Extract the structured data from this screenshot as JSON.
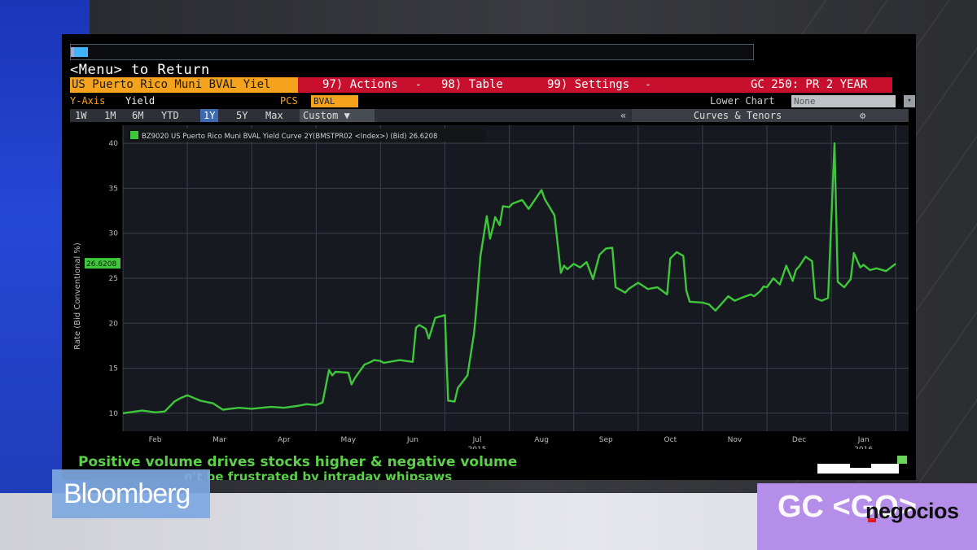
{
  "command": {
    "menu_return": "<Menu> to Return"
  },
  "toolbar": {
    "security": "US Puerto Rico Muni BVAL Yiel",
    "actions": "97) Actions",
    "table": "98) Table",
    "settings": "99) Settings",
    "function": "GC 250: PR 2 YEAR",
    "dropdown_glyph": "-"
  },
  "options": {
    "y_axis_label": "Y-Axis",
    "y_axis_value": "Yield",
    "pcs_label": "PCS",
    "pcs_value": "BVAL",
    "lower_chart_label": "Lower Chart",
    "lower_chart_value": "None"
  },
  "ranges": {
    "items": [
      "1W",
      "1M",
      "6M",
      "YTD",
      "1Y",
      "5Y",
      "Max"
    ],
    "selected": "1Y",
    "custom": "Custom ▼",
    "collapse": "«",
    "curves_tenors": "Curves & Tenors",
    "gear": "⚙"
  },
  "chart_data": {
    "type": "line",
    "legend": "BZ9020 US Puerto Rico Muni BVAL Yield Curve 2Y(BMSTPR02 <Index>) (Bid) 26.6208",
    "ylabel": "Rate (Bid Conventional %)",
    "ylim": [
      8,
      42
    ],
    "yticks": [
      10,
      15,
      20,
      25,
      30,
      35,
      40
    ],
    "last_value_label": "26.6208",
    "last_value": 26.6208,
    "x_ticks": [
      {
        "label": "Feb",
        "x": 0.5
      },
      {
        "label": "Mar",
        "x": 1.5
      },
      {
        "label": "Apr",
        "x": 2.5
      },
      {
        "label": "May",
        "x": 3.5
      },
      {
        "label": "Jun",
        "x": 4.5
      },
      {
        "label": "Jul",
        "x": 5.5
      },
      {
        "label": "Aug",
        "x": 6.5
      },
      {
        "label": "Sep",
        "x": 7.5
      },
      {
        "label": "Oct",
        "x": 8.5
      },
      {
        "label": "Nov",
        "x": 9.5
      },
      {
        "label": "Dec",
        "x": 10.5
      },
      {
        "label": "Jan",
        "x": 11.5
      }
    ],
    "year_labels": [
      {
        "label": "2015",
        "x": 5.5
      },
      {
        "label": "2016",
        "x": 11.5
      }
    ],
    "x_range": [
      0,
      12.2
    ],
    "line_color": "#3ec73a",
    "x": [
      0.0,
      0.3,
      0.5,
      0.65,
      0.8,
      0.9,
      1.0,
      1.2,
      1.4,
      1.55,
      1.8,
      2.0,
      2.3,
      2.5,
      2.7,
      2.85,
      3.0,
      3.1,
      3.2,
      3.25,
      3.3,
      3.5,
      3.55,
      3.6,
      3.75,
      3.85,
      3.9,
      4.0,
      4.05,
      4.3,
      4.5,
      4.55,
      4.6,
      4.7,
      4.75,
      4.85,
      5.0,
      5.05,
      5.15,
      5.2,
      5.35,
      5.45,
      5.48,
      5.55,
      5.65,
      5.7,
      5.75,
      5.78,
      5.85,
      5.9,
      6.0,
      6.05,
      6.2,
      6.3,
      6.5,
      6.55,
      6.7,
      6.8,
      6.85,
      6.9,
      7.0,
      7.1,
      7.2,
      7.3,
      7.4,
      7.5,
      7.6,
      7.65,
      7.8,
      7.85,
      8.0,
      8.15,
      8.3,
      8.45,
      8.5,
      8.6,
      8.7,
      8.75,
      8.8,
      9.0,
      9.1,
      9.2,
      9.4,
      9.5,
      9.6,
      9.75,
      9.8,
      9.9,
      9.95,
      10.0,
      10.1,
      10.2,
      10.3,
      10.4,
      10.45,
      10.5,
      10.6,
      10.7,
      10.75,
      10.85,
      10.95,
      11.05,
      11.1,
      11.2,
      11.3,
      11.35,
      11.45,
      11.5,
      11.6,
      11.7,
      11.85,
      12.0
    ],
    "y": [
      10.0,
      10.3,
      10.1,
      10.2,
      11.3,
      11.7,
      12.0,
      11.4,
      11.1,
      10.4,
      10.6,
      10.5,
      10.7,
      10.6,
      10.8,
      11.0,
      10.9,
      11.2,
      14.8,
      14.2,
      14.6,
      14.5,
      13.2,
      13.9,
      15.4,
      15.7,
      15.9,
      15.8,
      15.6,
      15.9,
      15.7,
      19.5,
      19.8,
      19.4,
      18.3,
      20.6,
      20.9,
      11.4,
      11.3,
      12.8,
      14.2,
      18.8,
      21.0,
      27.4,
      31.9,
      29.4,
      30.8,
      31.8,
      30.9,
      33.0,
      32.9,
      33.3,
      33.7,
      32.7,
      34.8,
      33.8,
      32.0,
      25.6,
      26.4,
      26.0,
      26.6,
      26.2,
      26.8,
      24.9,
      27.6,
      28.3,
      28.4,
      24.0,
      23.4,
      23.8,
      24.5,
      23.8,
      24.0,
      23.2,
      27.2,
      27.9,
      27.5,
      23.6,
      22.4,
      22.3,
      22.1,
      21.4,
      23.0,
      22.5,
      22.8,
      23.2,
      23.0,
      23.6,
      24.1,
      24.0,
      25.0,
      24.3,
      26.4,
      24.7,
      25.9,
      26.3,
      27.4,
      26.9,
      22.8,
      22.5,
      22.8,
      40.0,
      24.6,
      24.0,
      24.9,
      27.8,
      26.2,
      26.5,
      25.9,
      26.1,
      25.8,
      26.62
    ]
  },
  "ticker": {
    "line1": "Positive volume drives stocks higher & negative volume",
    "line2": "n't be frustrated by intraday whipsaws"
  },
  "broadcast": {
    "brand": "Bloomberg",
    "function_code": "GC <GO>",
    "watermark": "negocios"
  }
}
